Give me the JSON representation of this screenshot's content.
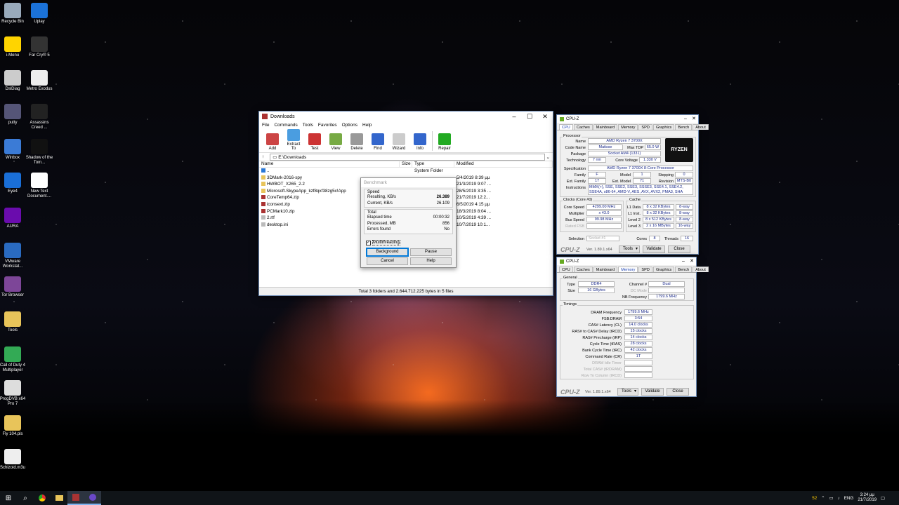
{
  "desktop": {
    "icons": [
      {
        "label": "Recycle Bin",
        "color": "#9ab"
      },
      {
        "label": "Uplay",
        "color": "#1b72d8"
      },
      {
        "label": "i-Menu",
        "color": "#ffd400"
      },
      {
        "label": "Far Cry® 5",
        "color": "#333"
      },
      {
        "label": "DslDiag",
        "color": "#ccc"
      },
      {
        "label": "Metro Exodus",
        "color": "#eee"
      },
      {
        "label": "putty",
        "color": "#557"
      },
      {
        "label": "Assassins Creed ...",
        "color": "#222"
      },
      {
        "label": "Winbox",
        "color": "#3b7bd6"
      },
      {
        "label": "Shadow of the Tom...",
        "color": "#111"
      },
      {
        "label": "Eye4",
        "color": "#1a6fd8"
      },
      {
        "label": "New Text Document....",
        "color": "#fff"
      },
      {
        "label": "AURA",
        "color": "#6a0cad"
      },
      {
        "label": "VMware Workstat...",
        "color": "#2a6bc1"
      },
      {
        "label": "Tor Browser",
        "color": "#7d4698"
      },
      {
        "label": "Tools",
        "color": "#e8c45a"
      },
      {
        "label": "Call of Duty 4 Multiplayer",
        "color": "#3a5"
      },
      {
        "label": "ProgDVB x64 Pro 7",
        "color": "#ddd"
      },
      {
        "label": "Fly 104.pls",
        "color": "#e8c45a"
      },
      {
        "label": "Schizoid.m3u",
        "color": "#eee"
      }
    ]
  },
  "winrar": {
    "title": "Downloads",
    "menu": [
      "File",
      "Commands",
      "Tools",
      "Favorites",
      "Options",
      "Help"
    ],
    "toolbar": [
      {
        "label": "Add",
        "icon": "add-icon",
        "color": "#c44"
      },
      {
        "label": "Extract To",
        "icon": "extract-icon",
        "color": "#4a9de0"
      },
      {
        "label": "Test",
        "icon": "test-icon",
        "color": "#c33"
      },
      {
        "label": "View",
        "icon": "view-icon",
        "color": "#7a4"
      },
      {
        "label": "Delete",
        "icon": "delete-icon",
        "color": "#999"
      },
      {
        "label": "Find",
        "icon": "find-icon",
        "color": "#36c"
      },
      {
        "label": "Wizard",
        "icon": "wizard-icon",
        "color": "#ccc"
      },
      {
        "label": "Info",
        "icon": "info-icon",
        "color": "#36c"
      },
      {
        "label": "Repair",
        "icon": "repair-icon",
        "color": "#2a2"
      }
    ],
    "address": "E:\\Downloads",
    "columns": [
      "Name",
      "Size",
      "Type",
      "Modified"
    ],
    "files": [
      {
        "name": "..",
        "size": "",
        "type": "System Folder",
        "modified": "",
        "kind": "up"
      },
      {
        "name": "3DMark-2016-spy",
        "size": "",
        "type": "",
        "modified": "5/4/2019 8:39 μμ",
        "kind": "folder"
      },
      {
        "name": "HWBOT_X265_2.2",
        "size": "",
        "type": "",
        "modified": "21/3/2019 9:07 ...",
        "kind": "folder"
      },
      {
        "name": "Microsoft.SkypeApp_kzf8qxf38zg5c!App",
        "size": "",
        "type": "",
        "modified": "28/5/2019 3:35 ...",
        "kind": "folder"
      },
      {
        "name": "CoreTemp64.zip",
        "size": "",
        "type": "",
        "modified": "21/7/2019 12:2...",
        "kind": "zip"
      },
      {
        "name": "iconsext.zip",
        "size": "",
        "type": "",
        "modified": "6/5/2019 4:15 μμ",
        "kind": "zip"
      },
      {
        "name": "PCMark10.zip",
        "size": "",
        "type": "",
        "modified": "18/3/2019 8:04 ...",
        "kind": "zip"
      },
      {
        "name": "2.rtf",
        "size": "",
        "type": "",
        "modified": "10/5/2019 4:39 ...",
        "kind": "file"
      },
      {
        "name": "desktop.ini",
        "size": "",
        "type": "",
        "modified": "10/7/2019 10:1...",
        "kind": "file"
      }
    ],
    "status": "Total 3 folders and 2.644.712.225 bytes in 5 files"
  },
  "benchmark": {
    "title": "Benchmark",
    "speed_label": "Speed",
    "resulting_label": "Resulting, KB/s",
    "resulting": "26.389",
    "current_label": "Current, KB/s",
    "current": "26.109",
    "total_label": "Total",
    "elapsed_label": "Elapsed time",
    "elapsed": "00:00:32",
    "processed_label": "Processed, MB",
    "processed": "856",
    "errors_label": "Errors found",
    "errors": "No",
    "multithreading": "Multithreading",
    "background": "Background",
    "pause": "Pause",
    "cancel": "Cancel",
    "help": "Help"
  },
  "cpuz1": {
    "title": "CPU-Z",
    "tabs": [
      "CPU",
      "Caches",
      "Mainboard",
      "Memory",
      "SPD",
      "Graphics",
      "Bench",
      "About"
    ],
    "processor": "Processor",
    "name_l": "Name",
    "name": "AMD Ryzen 7 3700X",
    "codename_l": "Code Name",
    "codename": "Matisse",
    "maxtdp_l": "Max TDP",
    "maxtdp": "65.0 W",
    "package_l": "Package",
    "package": "Socket AM4 (1331)",
    "tech_l": "Technology",
    "tech": "7 nm",
    "cvolt_l": "Core Voltage",
    "cvolt": "1.330 V",
    "spec_l": "Specification",
    "spec": "AMD Ryzen 7 3700X 8-Core Processor",
    "family_l": "Family",
    "family": "F",
    "model_l": "Model",
    "model": "1",
    "stepping_l": "Stepping",
    "stepping": "0",
    "extfam_l": "Ext. Family",
    "extfam": "17",
    "extmodel_l": "Ext. Model",
    "extmodel": "71",
    "revision_l": "Revision",
    "revision": "MTS-B0",
    "instr_l": "Instructions",
    "instr": "MMX(+), SSE, SSE2, SSE3, SSSE3, SSE4.1, SSE4.2, SSE4A, x86-64, AMD-V, AES, AVX, AVX2, FMA3, SHA",
    "clocks": "Clocks (Core #0)",
    "cache": "Cache",
    "corespeed_l": "Core Speed",
    "corespeed": "4299.00 MHz",
    "mult_l": "Multiplier",
    "mult": "x 43.0",
    "bus_l": "Bus Speed",
    "bus": "99.98 MHz",
    "fsb_l": "Rated FSB",
    "fsb": "",
    "l1d_l": "L1 Data",
    "l1d": "8 x 32 KBytes",
    "l1d_w": "8-way",
    "l1i_l": "L1 Inst.",
    "l1i": "8 x 32 KBytes",
    "l1i_w": "8-way",
    "l2_l": "Level 2",
    "l2": "8 x 512 KBytes",
    "l2_w": "8-way",
    "l3_l": "Level 3",
    "l3": "2 x 16 MBytes",
    "l3_w": "16-way",
    "selection_l": "Selection",
    "selection": "Socket #1",
    "cores_l": "Cores",
    "cores": "8",
    "threads_l": "Threads",
    "threads": "16",
    "brand": "CPU-Z",
    "ver": "Ver. 1.89.1.x64",
    "tools": "Tools",
    "validate": "Validate",
    "close": "Close",
    "logo": "RYZEN"
  },
  "cpuz2": {
    "title": "CPU-Z",
    "tabs": [
      "CPU",
      "Caches",
      "Mainboard",
      "Memory",
      "SPD",
      "Graphics",
      "Bench",
      "About"
    ],
    "general": "General",
    "type_l": "Type",
    "type": "DDR4",
    "channel_l": "Channel #",
    "channel": "Dual",
    "size_l": "Size",
    "size": "16 GBytes",
    "dcmode_l": "DC Mode",
    "dcmode": "",
    "nbfreq_l": "NB Frequency",
    "nbfreq": "1799.6 MHz",
    "timings": "Timings",
    "dram_l": "DRAM Frequency",
    "dram": "1799.6 MHz",
    "fsbdram_l": "FSB:DRAM",
    "fsbdram": "3:54",
    "cl_l": "CAS# Latency (CL)",
    "cl": "14.0 clocks",
    "trcd_l": "RAS# to CAS# Delay (tRCD)",
    "trcd": "15 clocks",
    "trp_l": "RAS# Precharge (tRP)",
    "trp": "14 clocks",
    "tras_l": "Cycle Time (tRAS)",
    "tras": "28 clocks",
    "trc_l": "Bank Cycle Time (tRC)",
    "trc": "42 clocks",
    "cr_l": "Command Rate (CR)",
    "cr": "1T",
    "idle_l": "DRAM Idle Timer",
    "idle": "",
    "trdram_l": "Total CAS# (tRDRAM)",
    "trdram": "",
    "trcd2_l": "Row To Column (tRCD)",
    "trcd2": "",
    "brand": "CPU-Z",
    "ver": "Ver. 1.89.1.x64",
    "tools": "Tools",
    "validate": "Validate",
    "close": "Close"
  },
  "taskbar": {
    "lang": "ENG",
    "time": "3:24 μμ",
    "date": "21/7/2019",
    "tray_num": "52"
  }
}
